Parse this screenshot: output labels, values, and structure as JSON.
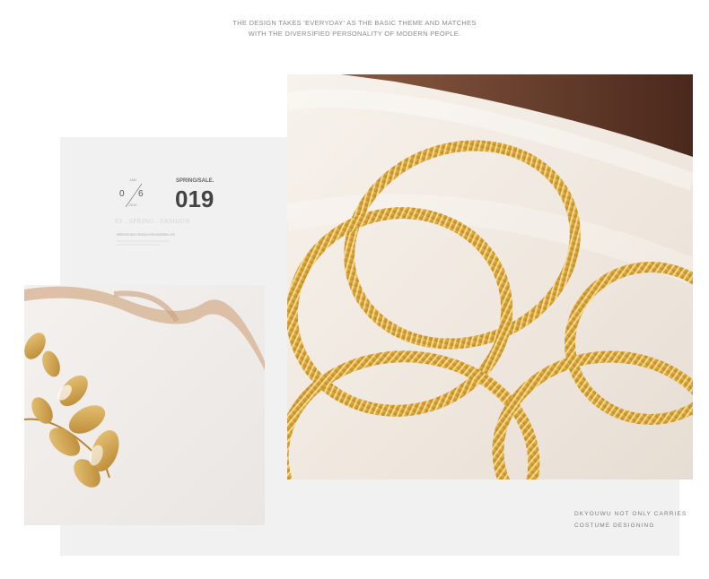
{
  "tagline": {
    "line1": "THE DESIGN TAKES 'EVERYDAY' AS THE BASIC THEME AND MATCHES",
    "line2": "WITH THE DIVERSIFIED PERSONALITY OF MODERN PEOPLE."
  },
  "stamp": {
    "date_month": "JAN",
    "date_left": "0",
    "date_right": "6",
    "date_year": "2019",
    "spring_sale": "SPRING/SALE.",
    "number": "019",
    "subtitle": "ES . SPRING . FASHION",
    "small_text": "IRRESISTIBLE DESIGN FOR MODERN LIFE"
  },
  "caption": {
    "line1": "DKYOUWU  NOT ONLY  CARRIES",
    "line2": "COSTUME DESIGNING"
  },
  "colors": {
    "gold": "#d9a53a",
    "gold_light": "#f2cf6e",
    "cloth": "#f3ede6",
    "wood": "#5b3324",
    "ribbon": "#d8b79a"
  }
}
